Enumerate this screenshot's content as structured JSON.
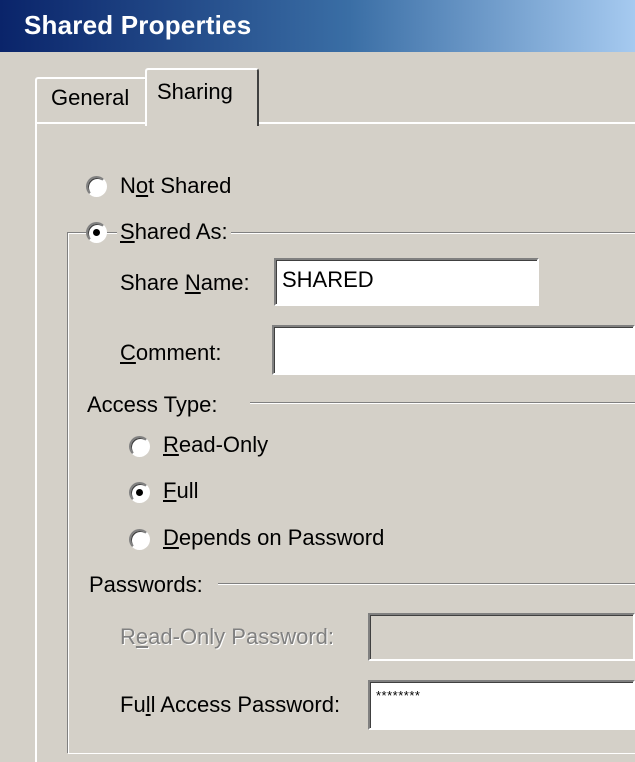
{
  "window": {
    "title": "Shared Properties"
  },
  "tabs": [
    {
      "label": "General",
      "selected": false
    },
    {
      "label": "Sharing",
      "selected": true
    }
  ],
  "sharing": {
    "not_shared": {
      "pre": "N",
      "key": "o",
      "post": "t Shared",
      "checked": false
    },
    "shared_as": {
      "pre": "",
      "key": "S",
      "post": "hared As:",
      "checked": true
    },
    "share_name": {
      "pre": "Share ",
      "key": "N",
      "post": "ame:",
      "value": "SHARED"
    },
    "comment": {
      "pre": "",
      "key": "C",
      "post": "omment:",
      "value": ""
    },
    "access_type": {
      "label": "Access Type:",
      "options": [
        {
          "pre": "",
          "key": "R",
          "post": "ead-Only",
          "checked": false
        },
        {
          "pre": "",
          "key": "F",
          "post": "ull",
          "checked": true
        },
        {
          "pre": "",
          "key": "D",
          "post": "epends on Password",
          "checked": false
        }
      ]
    },
    "passwords": {
      "label": "Passwords:",
      "read_only_password": {
        "pre": "R",
        "key": "e",
        "post": "ad-Only Password:",
        "value": "",
        "enabled": false
      },
      "full_access_password": {
        "pre": "Fu",
        "key": "l",
        "post": "l Access Password:",
        "value": "********",
        "enabled": true
      }
    }
  },
  "colors": {
    "face": "#d4d0c8",
    "title_start": "#0a246a",
    "title_end": "#a6caf0",
    "disabled_text": "#808080"
  }
}
